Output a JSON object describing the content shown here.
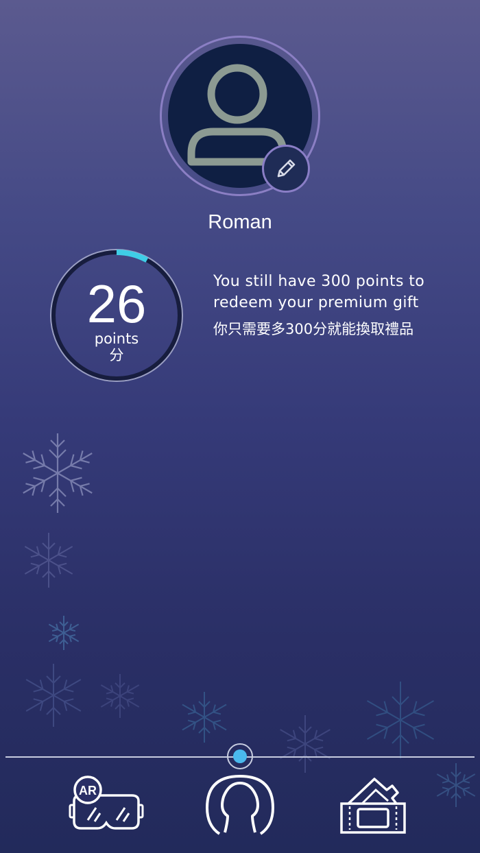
{
  "profile": {
    "username": "Roman",
    "avatar_icon": "user-icon",
    "edit_icon": "pencil-icon"
  },
  "points": {
    "value": "26",
    "unit_en": "points",
    "unit_cn": "分",
    "progress_fraction": 0.08,
    "progress_color": "#3fcde6"
  },
  "message": {
    "en": "You still have 300 points to redeem your premium gift",
    "cn": "你只需要多300分就能換取禮品"
  },
  "nav": {
    "items": [
      {
        "icon": "ar-headset-icon",
        "badge": "AR"
      },
      {
        "icon": "profile-head-icon",
        "selected": true
      },
      {
        "icon": "tickets-icon"
      }
    ],
    "indicator_color": "#4ab9ee"
  }
}
